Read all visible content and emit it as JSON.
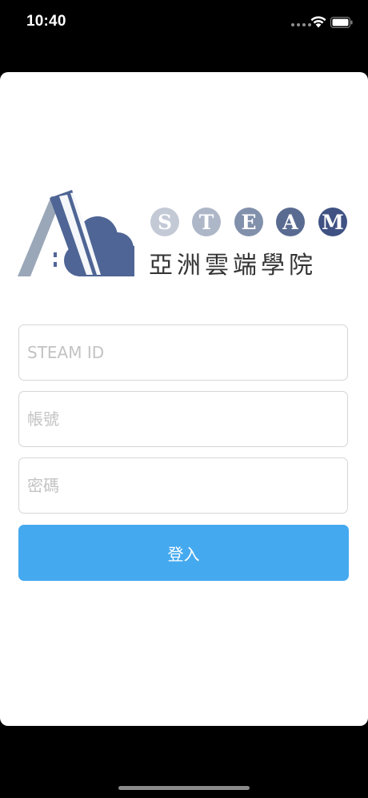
{
  "status_bar": {
    "time": "10:40"
  },
  "logo": {
    "letters": [
      "S",
      "T",
      "E",
      "A",
      "M"
    ],
    "letter_colors": [
      "#c3cad6",
      "#aeb7c8",
      "#8190ab",
      "#5a6b91",
      "#3f5283"
    ],
    "chinese_name": "亞洲雲端學院"
  },
  "form": {
    "steam_id": {
      "value": "",
      "placeholder": "STEAM ID"
    },
    "account": {
      "value": "",
      "placeholder": "帳號"
    },
    "password": {
      "value": "",
      "placeholder": "密碼"
    },
    "login_label": "登入"
  },
  "colors": {
    "button": "#45a9ef",
    "logo_primary": "#4f6595",
    "logo_secondary": "#9aa7b8"
  }
}
